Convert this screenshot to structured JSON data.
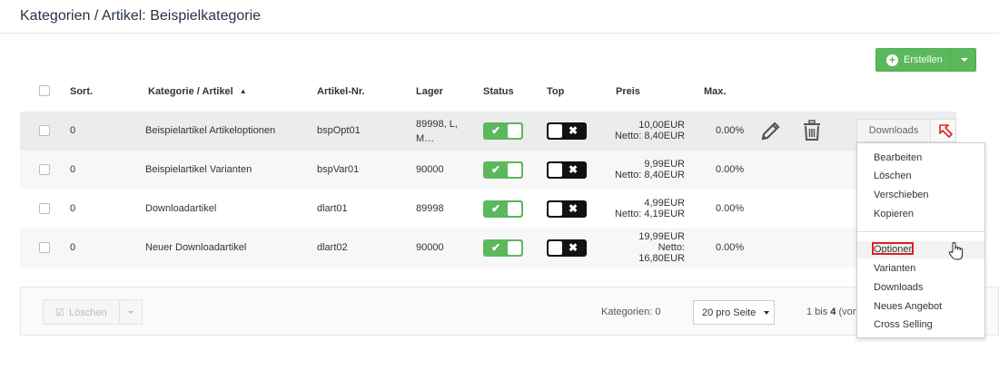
{
  "header": {
    "title": "Kategorien / Artikel: Beispielkategorie"
  },
  "toolbar": {
    "create_label": "Erstellen"
  },
  "table": {
    "columns": {
      "sort": "Sort.",
      "name": "Kategorie / Artikel",
      "artnr": "Artikel-Nr.",
      "stock": "Lager",
      "status": "Status",
      "top": "Top",
      "price": "Preis",
      "max": "Max."
    },
    "rows": [
      {
        "sort": "0",
        "name": "Beispielartikel Artikeloptionen",
        "artnr": "bspOpt01",
        "stock_line1": "89998, L,",
        "stock_line2": "M…",
        "price_line1": "10,00EUR",
        "price_line2": "Netto: 8,40EUR",
        "price_line3": "",
        "max": "0.00%",
        "status": true,
        "top": false
      },
      {
        "sort": "0",
        "name": "Beispielartikel Varianten",
        "artnr": "bspVar01",
        "stock_line1": "90000",
        "price_line1": "9,99EUR",
        "price_line2": "Netto: 8,40EUR",
        "price_line3": "",
        "max": "0.00%",
        "status": true,
        "top": false
      },
      {
        "sort": "0",
        "name": "Downloadartikel",
        "artnr": "dlart01",
        "stock_line1": "89998",
        "price_line1": "4,99EUR",
        "price_line2": "Netto: 4,19EUR",
        "price_line3": "",
        "max": "0.00%",
        "status": true,
        "top": false
      },
      {
        "sort": "0",
        "name": "Neuer Downloadartikel",
        "artnr": "dlart02",
        "stock_line1": "90000",
        "price_line1": "19,99EUR",
        "price_line2": "Netto:",
        "price_line3": "16,80EUR",
        "max": "0.00%",
        "status": true,
        "top": false
      }
    ]
  },
  "row_actions": {
    "downloads_label": "Downloads"
  },
  "dropdown": {
    "items": [
      "Bearbeiten",
      "Löschen",
      "Verschieben",
      "Kopieren",
      "Optionen",
      "Varianten",
      "Downloads",
      "Neues Angebot",
      "Cross Selling"
    ]
  },
  "footer": {
    "delete_label": "Löschen",
    "categories_count": "Kategorien: 0",
    "per_page": "20 pro Seite",
    "pagination_prefix": "1 bis ",
    "pagination_bold": "4",
    "pagination_suffix": " (von"
  },
  "colors": {
    "accent_green": "#5cb85c",
    "highlight_red": "#e02020"
  },
  "icons": [
    "plus-circle-icon",
    "caret-down-icon",
    "sort-asc-icon",
    "check-icon",
    "x-icon",
    "pencil-icon",
    "trash-icon",
    "arrow-pointer-icon",
    "hand-cursor-icon",
    "checkbox-icon"
  ]
}
